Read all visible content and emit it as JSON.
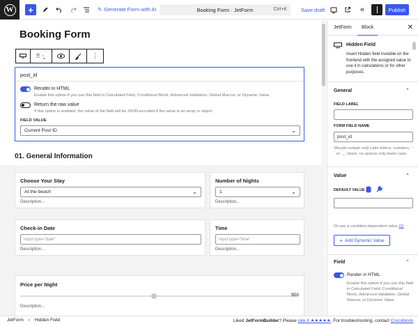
{
  "toolbar": {
    "generate_label": "Generate Form with AI",
    "doc_title": "Booking Form · JetForm",
    "shortcut": "Ctrl+K",
    "save_draft": "Save draft",
    "publish": "Publish"
  },
  "page": {
    "title": "Booking Form"
  },
  "hidden_field": {
    "name": "post_id",
    "render_label": "Render in HTML",
    "render_help": "Enable this option if you use this field in Calculated Field, Conditional Block, Advanced Validation, Global Macros, or Dynamic Value.",
    "raw_label": "Return the raw value",
    "raw_help": "If this option is enabled, the value of the field will be JSON-encoded if the value is an array or object",
    "value_caption": "Field Value",
    "value_selected": "Current Post ID"
  },
  "section": {
    "title": "01. General Information"
  },
  "fields": {
    "stay": {
      "label": "Choose Your Stay",
      "value": "At the beach",
      "desc": "Description..."
    },
    "nights": {
      "label": "Number of Nights",
      "value": "1",
      "desc": "Description..."
    },
    "checkin": {
      "label": "Check-in Date",
      "placeholder": "Input type=\"date\"",
      "desc": "Description..."
    },
    "time": {
      "label": "Time",
      "placeholder": "Input type=\"time\"",
      "desc": "Description..."
    },
    "price": {
      "label": "Price per Night",
      "value": "$50",
      "desc": "Description..."
    }
  },
  "footer": {
    "crumb_root": "JetForm",
    "crumb_sep": "›",
    "crumb_item": "Hidden Field",
    "rate_prefix": "Liked ",
    "rate_brand": "JetFormBuilder",
    "rate_mid": "? Please ",
    "rate_link": "rate it ★★★★★",
    "rate_suffix": ". For troubleshooting, contact ",
    "support_link": "Crocoblock support"
  },
  "sidebar": {
    "tab_jetform": "JetForm",
    "tab_block": "Block",
    "block_title": "Hidden Field",
    "block_desc": "Insert Hidden field invisible on the frontend with the assigned value to use it in calculations or for other purposes.",
    "general": {
      "title": "General",
      "label_caption": "Field Label",
      "label_value": "",
      "name_caption": "Form Field Name",
      "name_value": "post_id",
      "name_help": "Should contain only Latin letters, numbers, `-` or `_` chars, no spaces only lower case"
    },
    "value": {
      "title": "Value",
      "default_caption": "Default Value",
      "condition_text": "Or use a condition-dependent value",
      "condition_count": "(2)",
      "add_dynamic": "Add Dynamic Value"
    },
    "field": {
      "title": "Field",
      "render_label": "Render in HTML",
      "render_help": "Enable this option if you use this field in Calculated Field, Conditional Block, Advanced Validation, Global Macros, or Dynamic Value."
    }
  },
  "colors": {
    "accent": "#3858e9",
    "dark": "#1e1e1e"
  },
  "price_slider_fraction": 0.48
}
